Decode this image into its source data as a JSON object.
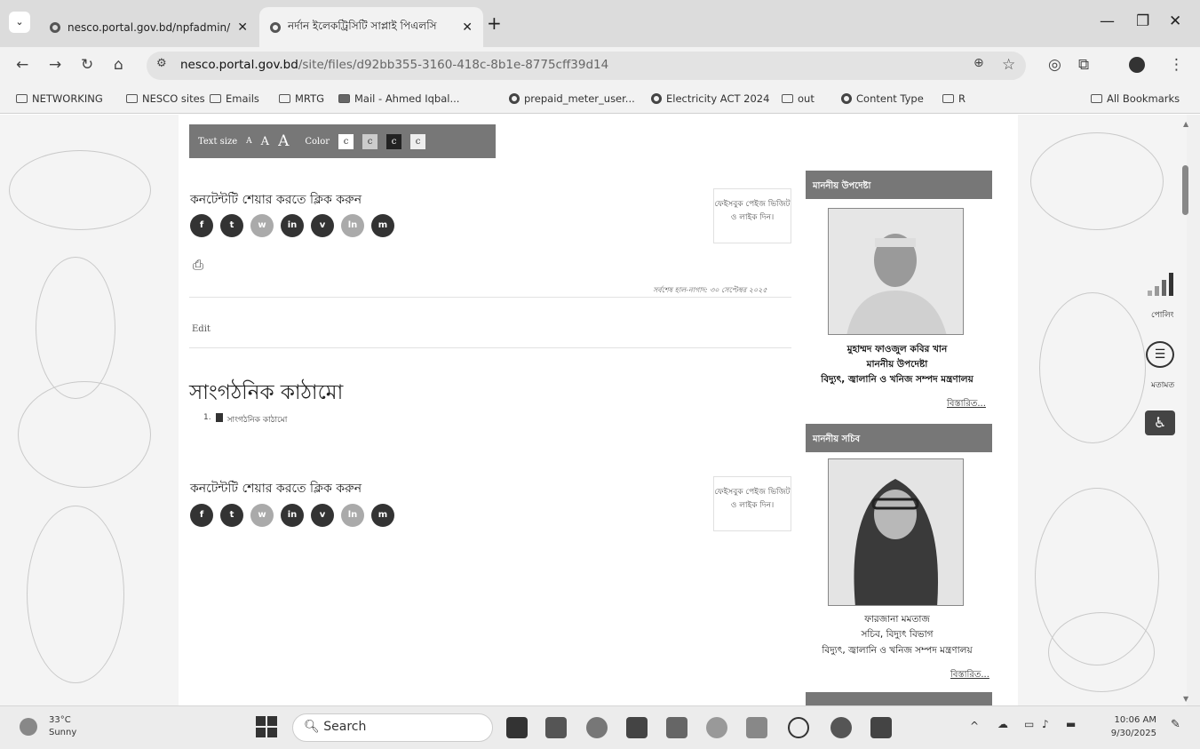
{
  "browser": {
    "tabs": [
      {
        "title": "nesco.portal.gov.bd/npfadmin/"
      },
      {
        "title": "নর্দান ইলেকট্রিসিটি সাপ্লাই পিএলসি"
      }
    ],
    "url_host": "nesco.portal.gov.bd",
    "url_path": "/site/files/d92bb355-3160-418c-8b1e-8775cff39d14",
    "bookmarks": [
      "NETWORKING",
      "NESCO sites",
      "Emails",
      "MRTG",
      "Mail - Ahmed Iqbal...",
      "prepaid_meter_user...",
      "Electricity ACT 2024",
      "out",
      "Content Type",
      "R"
    ],
    "all_bookmarks": "All Bookmarks"
  },
  "toolbar": {
    "text_size_label": "Text size",
    "size_small": "A",
    "size_medium": "A",
    "size_large": "A",
    "color_label": "Color",
    "color_options": [
      "c",
      "c",
      "c",
      "c"
    ]
  },
  "content": {
    "share_label": "কনটেন্টটি শেয়ার করতে ক্লিক করুন",
    "fb_box": "ফেইসবুক পেইজ ভিজিট ও লাইক দিন।",
    "last_updated": "সর্বশেষ হাল-নাগাদ: ৩০ সেপ্টেম্বর ২০২৫",
    "edit_link": "Edit",
    "page_title": "সাংগঠনিক কাঠামো",
    "list_item_num": "1.",
    "list_item": "সাংগঠনিক কাঠামো",
    "share_icons": [
      "f",
      "t",
      "w",
      "in",
      "v",
      "ln",
      "m"
    ]
  },
  "sidebar": {
    "advisor_head": "মাননীয় উপদেষ্টা",
    "advisor_name": "মুহাম্মদ ফাওজুল কবির খান",
    "advisor_title": "মাননীয় উপদেষ্টা",
    "advisor_ministry": "বিদ্যুৎ, জ্বালানি ও খনিজ সম্পদ মন্ত্রণালয়",
    "more1": "বিস্তারিত...",
    "secretary_head": "মাননীয় সচিব",
    "secretary_name": "ফারজানা মমতাজ",
    "secretary_title": "সচিব, বিদ্যুৎ বিভাগ",
    "secretary_ministry": "বিদ্যুৎ, জ্বালানি ও খনিজ সম্পদ মন্ত্রণালয়",
    "more2": "বিস্তারিত..."
  },
  "widgets": {
    "poll_label": "পোলিং",
    "feedback_label": "মতামত"
  },
  "taskbar": {
    "temp": "33°C",
    "weather": "Sunny",
    "search_placeholder": "Search",
    "time": "10:06 AM",
    "date": "9/30/2025"
  }
}
